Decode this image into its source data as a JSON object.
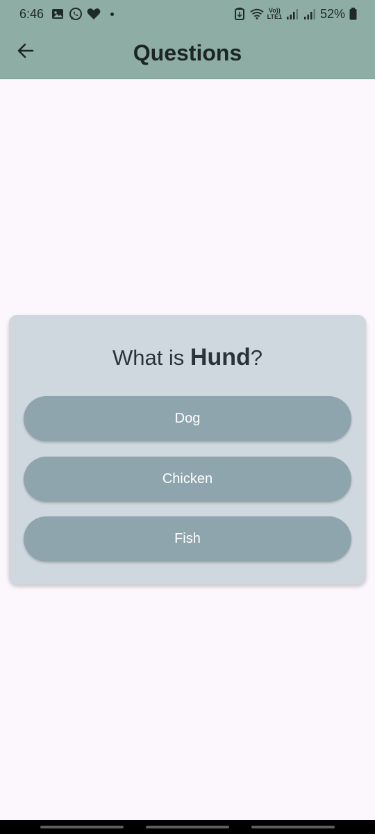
{
  "status_bar": {
    "time": "6:46",
    "battery": "52%",
    "volte_top": "Vo))",
    "volte_bottom": "LTE1",
    "icons": [
      "gallery-icon",
      "whatsapp-icon",
      "heart-icon",
      "dot-icon",
      "battery-saver-icon",
      "wifi-icon",
      "signal-icon",
      "signal-icon",
      "battery-icon"
    ]
  },
  "app_bar": {
    "title": "Questions",
    "back_icon": "arrow-back-icon",
    "background": "#8eada4"
  },
  "quiz": {
    "question_prefix": "What is ",
    "word": "Hund",
    "question_suffix": "?",
    "answers": [
      {
        "label": "Dog"
      },
      {
        "label": "Chicken"
      },
      {
        "label": "Fish"
      }
    ],
    "card_color": "#d0d8df",
    "button_color": "#8fa5ae"
  }
}
